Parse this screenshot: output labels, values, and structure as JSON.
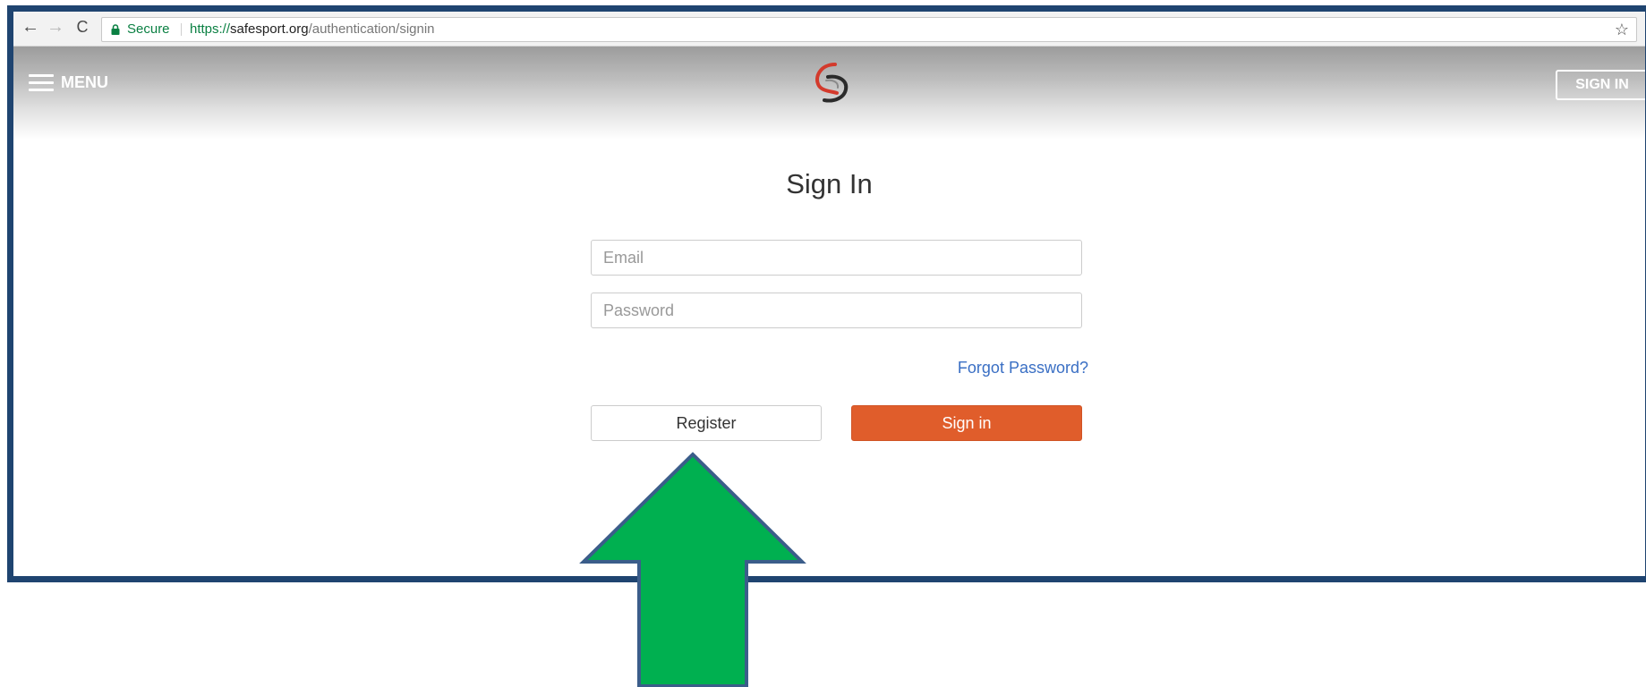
{
  "browser": {
    "secure_label": "Secure",
    "url_scheme": "https://",
    "url_host": "safesport.org",
    "url_path": "/authentication/signin",
    "icons": {
      "back": "arrow-left-icon",
      "forward": "arrow-right-icon",
      "reload": "reload-icon",
      "lock": "lock-icon",
      "bookmark": "star-icon"
    }
  },
  "header": {
    "menu_label": "MENU",
    "signin_label": "SIGN IN",
    "logo": "safesport-logo"
  },
  "form": {
    "title": "Sign In",
    "email_placeholder": "Email",
    "password_placeholder": "Password",
    "forgot_label": "Forgot Password?",
    "register_label": "Register",
    "signin_label": "Sign in"
  },
  "colors": {
    "frame_border": "#1f4470",
    "signin_button": "#e05d2b",
    "link": "#3a6fc4",
    "secure_green": "#0b8043",
    "annotation_arrow": "#00b050",
    "annotation_outline": "#3b5d8a"
  }
}
